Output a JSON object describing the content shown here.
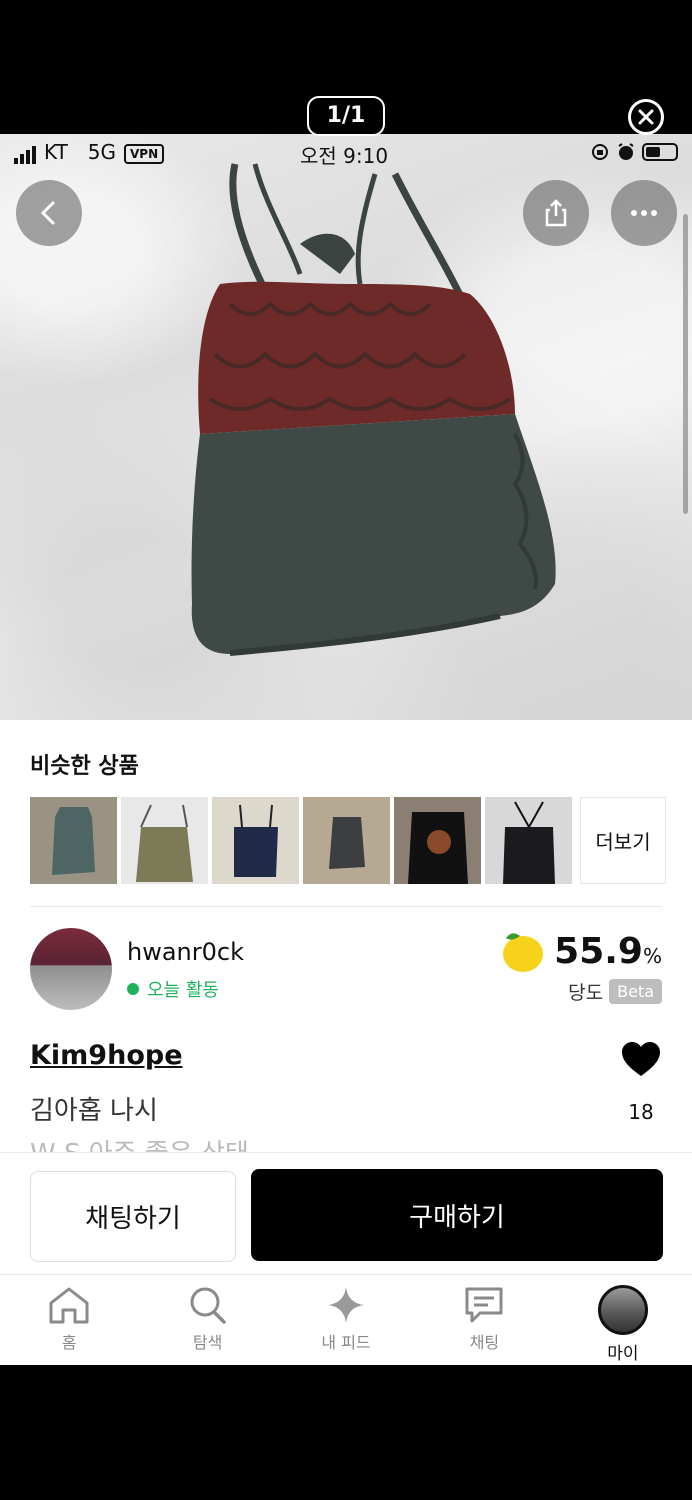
{
  "viewer": {
    "counter": "1/1"
  },
  "status_bar": {
    "carrier": "KT",
    "network": "5G",
    "vpn": "VPN",
    "time": "오전 9:10"
  },
  "similar": {
    "title": "비슷한 상품",
    "thumbnails": [
      "teal-tank",
      "olive-cami",
      "navy-cami",
      "gray-tank",
      "black-sequin-top",
      "black-halter-top"
    ],
    "more_label": "더보기"
  },
  "seller": {
    "name": "hwanr0ck",
    "activity": "오늘 활동",
    "sweetness_value": "55.9",
    "sweetness_unit": "%",
    "sweetness_label": "당도",
    "beta": "Beta"
  },
  "product": {
    "brand": "Kim9hope",
    "title": "김아홉 나시",
    "truncated_desc": "W          S   아주 좋은 상태",
    "likes": "18"
  },
  "actions": {
    "chat": "채팅하기",
    "buy": "구매하기"
  },
  "tabs": [
    {
      "label": "홈",
      "icon": "home-icon"
    },
    {
      "label": "탐색",
      "icon": "search-icon"
    },
    {
      "label": "내 피드",
      "icon": "sparkle-icon"
    },
    {
      "label": "채팅",
      "icon": "chat-icon"
    },
    {
      "label": "마이",
      "icon": "avatar"
    }
  ],
  "colors": {
    "accent_green": "#1db35c",
    "primary_button": "#000000",
    "beta_badge": "#bdbdbd"
  }
}
